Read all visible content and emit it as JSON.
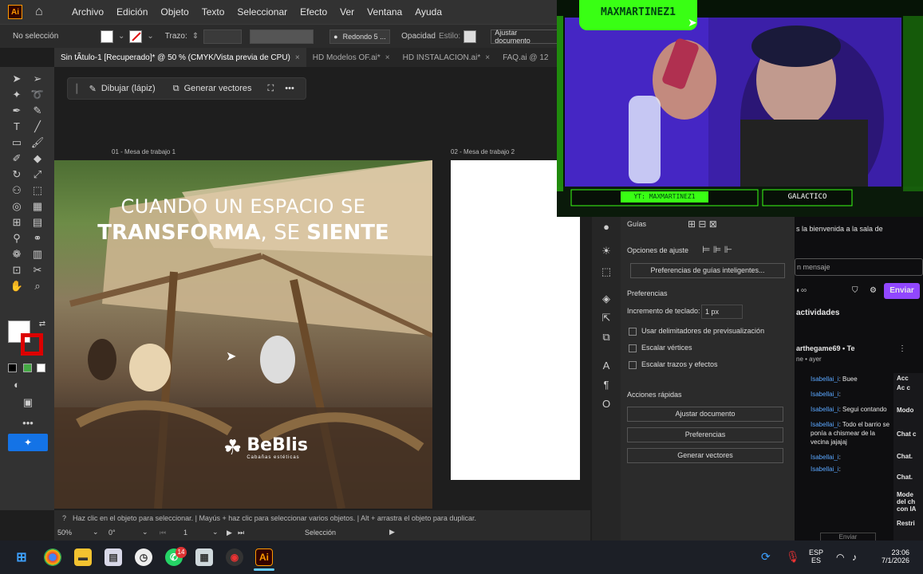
{
  "menubar": {
    "logo": "Ai",
    "items": [
      "Archivo",
      "Edición",
      "Objeto",
      "Texto",
      "Seleccionar",
      "Efecto",
      "Ver",
      "Ventana",
      "Ayuda"
    ]
  },
  "control_bar": {
    "selection": "No selección",
    "stroke_label": "Trazo:",
    "brush": "Redondo 5 ...",
    "opacity_label": "Opacidad",
    "style_label": "Estilo:",
    "fit_button": "Ajustar documento"
  },
  "tabs": [
    {
      "label": "Sin tÃtulo-1 [Recuperado]* @ 50 % (CMYK/Vista previa de CPU)",
      "active": true
    },
    {
      "label": "HD Modelos OF.ai*"
    },
    {
      "label": "HD INSTALACION.ai*"
    },
    {
      "label": "FAQ.ai @ 12"
    }
  ],
  "context_bar": {
    "draw": "Dibujar (lápiz)",
    "vectors": "Generar vectores"
  },
  "artboards": {
    "one": "01 - Mesa de trabajo 1",
    "two": "02 - Mesa de trabajo 2"
  },
  "artwork": {
    "line1": "CUANDO UN ESPACIO SE",
    "line2_a": "TRANSFORMA",
    "line2_b": ", SE ",
    "line2_c": "SIENTE",
    "brand": "BeBlis",
    "brand_sub": "Cabañas estéticas"
  },
  "status": {
    "hint": "Haz clic en el objeto para seleccionar. | Mayús + haz clic para seleccionar varios objetos. | Alt + arrastra el objeto para duplicar.",
    "zoom": "50%",
    "angle": "0°",
    "page": "1",
    "mode": "Selección"
  },
  "right_panel": {
    "guides": "Guías",
    "snap_options": "Opciones de ajuste",
    "smart_guides": "Preferencias de guías inteligentes...",
    "prefs_title": "Preferencias",
    "keyboard_inc": "Incremento de teclado:",
    "keyboard_val": "1 px",
    "chk1": "Usar delimitadores de previsualización",
    "chk2": "Escalar vértices",
    "chk3": "Escalar trazos y efectos",
    "quick_actions": "Acciones rápidas",
    "btn1": "Ajustar documento",
    "btn2": "Preferencias",
    "btn3": "Generar vectores"
  },
  "chat": {
    "welcome": "s la bienvenida a la sala de",
    "input_placeholder": "n mensaje",
    "send": "Enviar",
    "activities": "actividades",
    "notif_user": "arthegame69 • Te",
    "notif_sub": "ne • ayer",
    "messages": [
      {
        "user": "Isabellai_i",
        "text": ": Buee"
      },
      {
        "user": "Isabellai_i",
        "text": ":"
      },
      {
        "user": "Isabellai_i",
        "text": ": Segui contando"
      },
      {
        "user": "Isabellai_i",
        "text": ": Todo el barrio se ponía a chismear de la vecina jajajaj"
      },
      {
        "user": "Isabellai_i",
        "text": ":"
      },
      {
        "user": "Isabellai_i",
        "text": ":"
      }
    ],
    "side_labels": [
      "Acc",
      "Ac c",
      "Modo",
      "Chat c",
      "Chat.",
      "Chat.",
      "Mode del ch con IA",
      "Restri"
    ],
    "bottom_send": "Enviar"
  },
  "webcam": {
    "name": "MAXMARTINEZ1",
    "yt": "YT: MAXMARTINEZ1",
    "tag": "GALACTICO"
  },
  "taskbar": {
    "lang1": "ESP",
    "lang2": "ES",
    "time": "23:06",
    "date": "7/1/2026",
    "badge": "14"
  },
  "colors": {
    "accent_ai": "#ff9a00",
    "neon": "#39ff14",
    "twitch": "#9147ff"
  }
}
